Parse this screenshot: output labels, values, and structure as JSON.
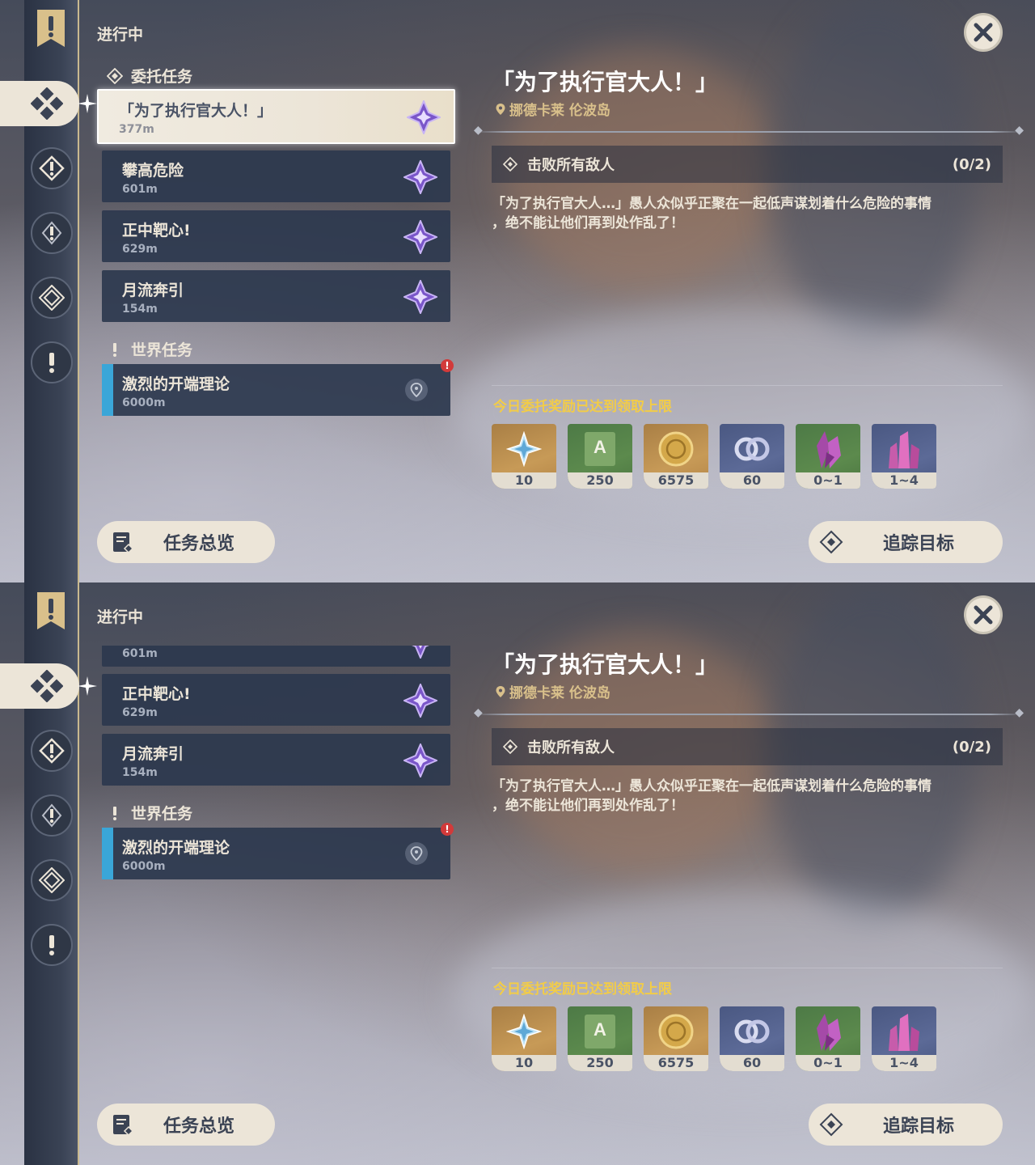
{
  "sidebar": {
    "section_in_progress": "进行中"
  },
  "quest_list": {
    "commission_header": "委托任务",
    "world_header": "世界任务",
    "commissions": [
      {
        "title": "「为了执行官大人！」",
        "distance": "377m"
      },
      {
        "title": "攀高危险",
        "distance": "601m"
      },
      {
        "title": "正中靶心!",
        "distance": "629m"
      },
      {
        "title": "月流奔引",
        "distance": "154m"
      }
    ],
    "world": [
      {
        "title": "激烈的开端理论",
        "distance": "6000m",
        "alert": "!"
      }
    ],
    "scrolled_partial_distance": "601m"
  },
  "detail": {
    "title": "「为了执行官大人！」",
    "location": "挪德卡莱 伦波岛",
    "objective": "击败所有敌人",
    "objective_count": "(0/2)",
    "description_line1": "「为了执行官大人…」愚人众似乎正聚在一起低声谋划着什么危险的事情",
    "description_line2": "，绝不能让他们再到处作乱了！",
    "reward_note": "今日委托奖励已达到领取上限",
    "rewards": [
      {
        "icon": "primogem-icon",
        "count": "10"
      },
      {
        "icon": "adventure-exp-icon",
        "count": "250"
      },
      {
        "icon": "mora-icon",
        "count": "6575"
      },
      {
        "icon": "companionship-exp-icon",
        "count": "60"
      },
      {
        "icon": "crystal-ore-icon",
        "count": "0~1"
      },
      {
        "icon": "crystal-cluster-icon",
        "count": "1~4"
      }
    ]
  },
  "buttons": {
    "overview": "任务总览",
    "track": "追踪目标"
  },
  "colors": {
    "accent_cream": "#ece5d8",
    "reward_note_yellow": "#f2cc48",
    "location_gold": "#d9c08b",
    "world_strip_blue": "#3aa6d8",
    "alert_red": "#d23a3a"
  }
}
